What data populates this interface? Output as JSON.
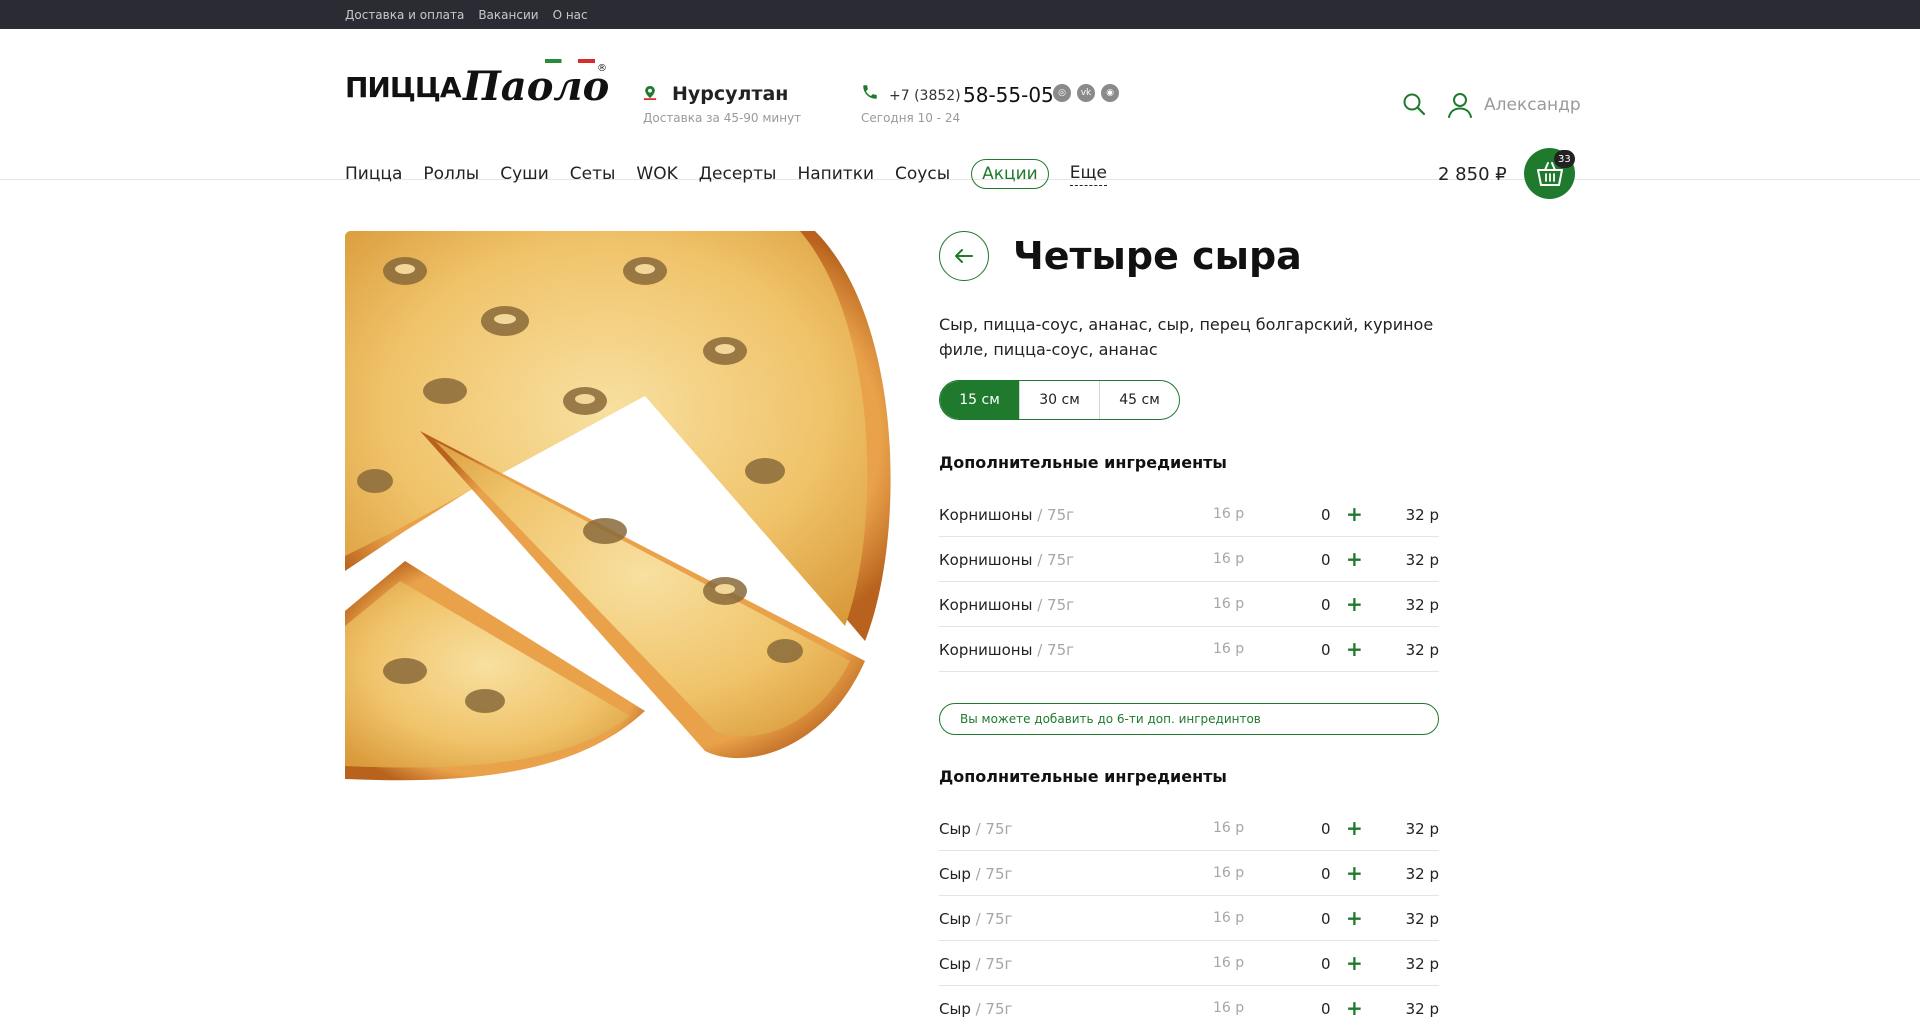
{
  "topbar": {
    "links": [
      "Доставка и оплата",
      "Вакансии",
      "О нас"
    ]
  },
  "logo": {
    "text_1": "ПИЦЦА",
    "text_2": "Паоло",
    "reg": "®"
  },
  "city": {
    "name": "Нурсултан",
    "delivery": "Доставка за 45-90 минут"
  },
  "phone": {
    "code": "+7 (3852)",
    "number": "58-55-05",
    "hours": "Сегодня 10 - 24"
  },
  "user": {
    "name": "Александр"
  },
  "nav": {
    "items": [
      "Пицца",
      "Роллы",
      "Суши",
      "Сеты",
      "WOK",
      "Десерты",
      "Напитки",
      "Соусы"
    ],
    "promo": "Акции",
    "more": "Еще"
  },
  "cart": {
    "total": "2 850 ₽",
    "count": "33"
  },
  "product": {
    "title": "Четыре сыра",
    "description": "Сыр, пицца-соус, ананас, сыр, перец болгарский, куриное филе, пицца-соус, ананас",
    "sizes": [
      "15 см",
      "30 см",
      "45 см"
    ],
    "selected_size": "15 см"
  },
  "extras_1": {
    "title": "Дополнительные ингредиенты",
    "rows": [
      {
        "name": "Корнишоны",
        "weight": " / 75г",
        "price": "16 р",
        "qty": "0",
        "total": "32 р"
      },
      {
        "name": "Корнишоны",
        "weight": " / 75г",
        "price": "16 р",
        "qty": "0",
        "total": "32 р"
      },
      {
        "name": "Корнишоны",
        "weight": " / 75г",
        "price": "16 р",
        "qty": "0",
        "total": "32 р"
      },
      {
        "name": "Корнишоны",
        "weight": " / 75г",
        "price": "16 р",
        "qty": "0",
        "total": "32 р"
      }
    ]
  },
  "notice": "Вы можете добавить до 6-ти доп. ингрединтов",
  "extras_2": {
    "title": "Дополнительные ингредиенты",
    "rows": [
      {
        "name": "Сыр",
        "weight": " / 75г",
        "price": "16 р",
        "qty": "0",
        "total": "32 р"
      },
      {
        "name": "Сыр",
        "weight": " / 75г",
        "price": "16 р",
        "qty": "0",
        "total": "32 р"
      },
      {
        "name": "Сыр",
        "weight": " / 75г",
        "price": "16 р",
        "qty": "0",
        "total": "32 р"
      },
      {
        "name": "Сыр",
        "weight": " / 75г",
        "price": "16 р",
        "qty": "0",
        "total": "32 р"
      },
      {
        "name": "Сыр",
        "weight": " / 75г",
        "price": "16 р",
        "qty": "0",
        "total": "32 р"
      }
    ]
  },
  "plus_symbol": "+",
  "colors": {
    "brand_green": "#1f7a2e",
    "topbar": "#2b2b33"
  }
}
